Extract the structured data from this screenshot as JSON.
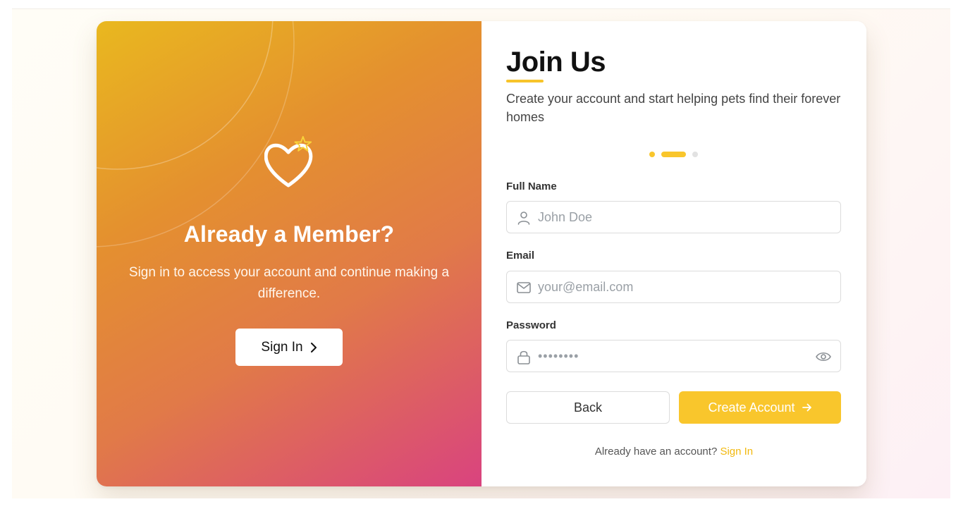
{
  "left_panel": {
    "title": "Already a Member?",
    "description": "Sign in to access your account and continue making a difference.",
    "signin_button": "Sign In",
    "icon": "heart-star-icon"
  },
  "form": {
    "title": "Join Us",
    "subtitle": "Create your account and start helping pets find their forever homes",
    "step_indicator": {
      "current": 2,
      "total": 3
    },
    "full_name": {
      "label": "Full Name",
      "placeholder": "John Doe",
      "icon": "user-icon"
    },
    "email": {
      "label": "Email",
      "placeholder": "your@email.com",
      "icon": "mail-icon"
    },
    "password": {
      "label": "Password",
      "masked_value": "••••••••",
      "icon": "lock-icon",
      "toggle_icon": "eye-icon"
    },
    "back_button": "Back",
    "create_button": "Create Account",
    "footer_text": "Already have an account?",
    "footer_link": "Sign In"
  },
  "colors": {
    "accent": "#f9c62c",
    "gradient_start": "#e9b81f",
    "gradient_end": "#d9437f",
    "step_inactive": "#e2e2e2"
  }
}
